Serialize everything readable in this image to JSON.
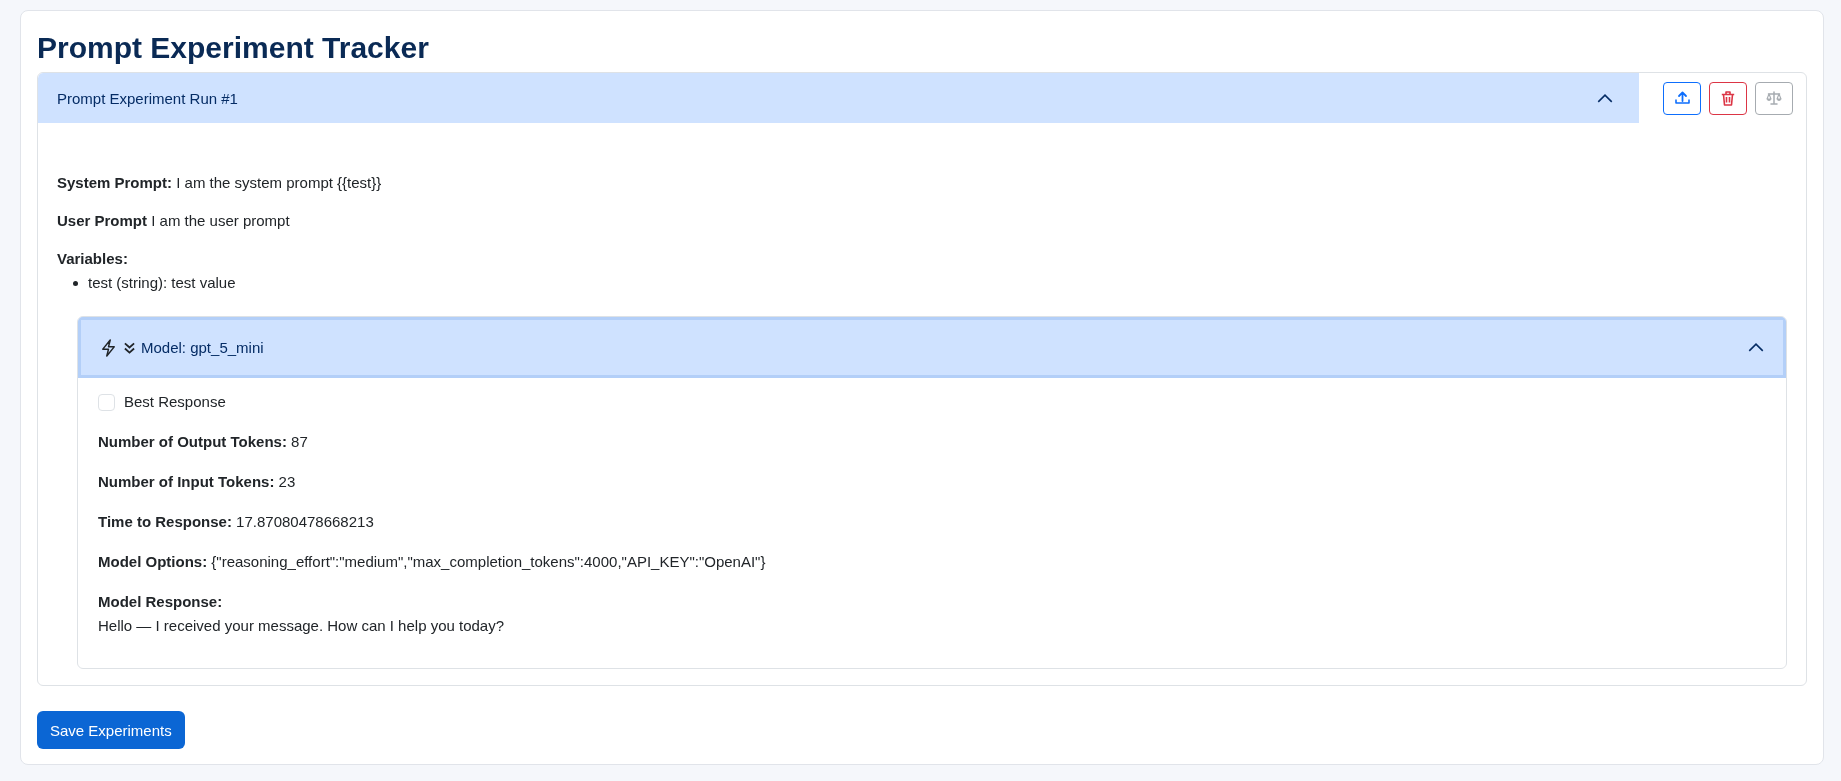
{
  "title": "Prompt Experiment Tracker",
  "runs": [
    {
      "title": "Prompt Experiment Run #1",
      "expanded": true,
      "actions": [
        {
          "kind": "upload",
          "disabled": false
        },
        {
          "kind": "delete",
          "disabled": false
        },
        {
          "kind": "compare",
          "disabled": true
        }
      ],
      "fields": [
        "**System Prompt:** I am the system prompt {{test}}",
        "**User Prompt** I am the user prompt"
      ],
      "variables": {
        "label": "Variables:",
        "items": [
          "test (string): test value"
        ]
      },
      "models": [
        {
          "title": "Model: gpt_5_mini",
          "expanded": true,
          "focused": true,
          "best_response": {
            "label": "Best Response",
            "checked": false
          },
          "fields": [
            "**Number of Output Tokens:** 87",
            "**Number of Input Tokens:** 23",
            "**Time to Response:** 17.87080478668213",
            "**Model Options:** {\"reasoning_effort\":\"medium\",\"max_completion_tokens\":4000,\"API_KEY\":\"OpenAI\"}"
          ],
          "response": {
            "label": "Model Response:",
            "text": "Hello — I received your message. How can I help you today?"
          }
        }
      ]
    }
  ],
  "save_button": "Save Experiments"
}
